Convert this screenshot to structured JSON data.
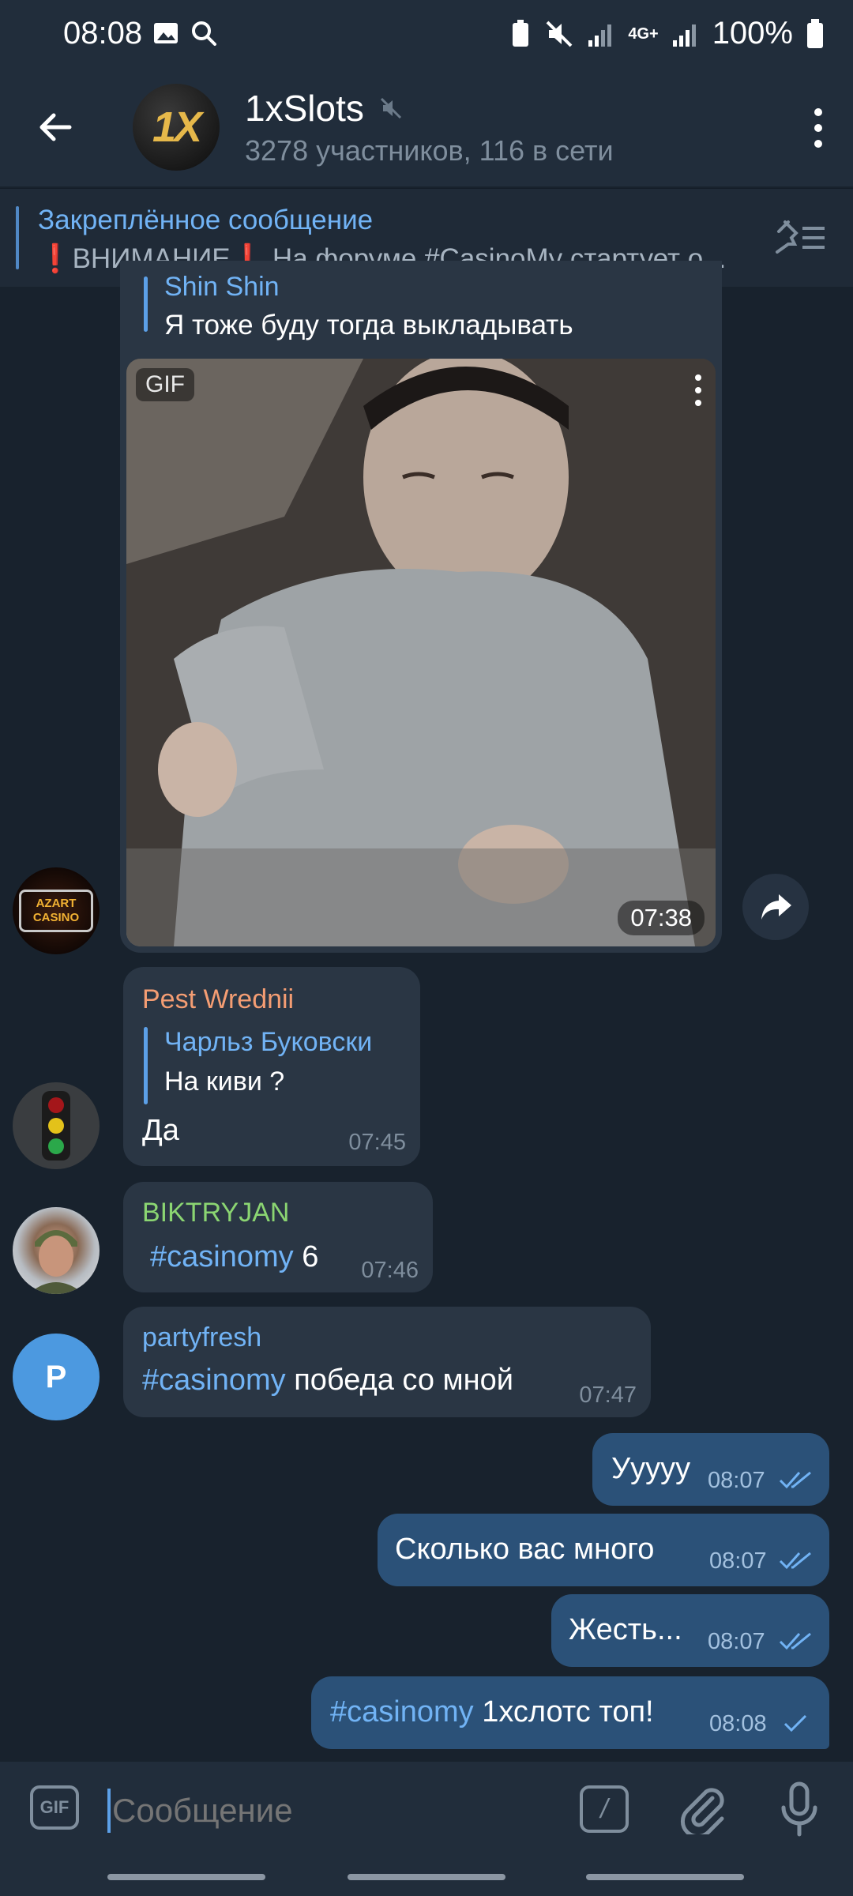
{
  "status": {
    "time": "08:08",
    "network": "4G+",
    "battery": "100%"
  },
  "header": {
    "title": "1xSlots",
    "subtitle": "3278 участников, 116 в сети",
    "avatar_text": "1X"
  },
  "pinned": {
    "title": "Закреплённое сообщение",
    "text": "❗ВНИМАНИЕ❗ На форуме #CasinoMy стартует о..."
  },
  "messages": {
    "m1": {
      "reply_author": "Shin Shin",
      "reply_text": "Я тоже буду тогда выкладывать",
      "gif_label": "GIF",
      "time": "07:38",
      "avatar_text": "AZART CASINO"
    },
    "m2": {
      "author": "Pest Wrednii",
      "reply_author": "Чарльз Буковски",
      "reply_text": "На киви ?",
      "text": "Да",
      "time": "07:45"
    },
    "m3": {
      "author": "BIKTRYJAN",
      "hashtag": "#casinomy",
      "text": " 6",
      "time": "07:46"
    },
    "m4": {
      "author": "partyfresh",
      "hashtag": "#casinomy",
      "text": " победа со мной",
      "time": "07:47",
      "avatar_letter": "P"
    },
    "o1": {
      "text": "Ууууу",
      "time": "08:07"
    },
    "o2": {
      "text": "Сколько вас много",
      "time": "08:07"
    },
    "o3": {
      "text": "Жесть...",
      "time": "08:07"
    },
    "o4": {
      "hashtag": "#casinomy",
      "text": " 1хслотс топ!",
      "time": "08:08"
    }
  },
  "input": {
    "placeholder": "Сообщение",
    "gif_label": "GIF",
    "command_label": "/"
  },
  "colors": {
    "background": "#18222d",
    "header": "#212d3b",
    "incoming": "#2a3644",
    "outgoing": "#2b5178",
    "accent": "#71b3f5"
  }
}
